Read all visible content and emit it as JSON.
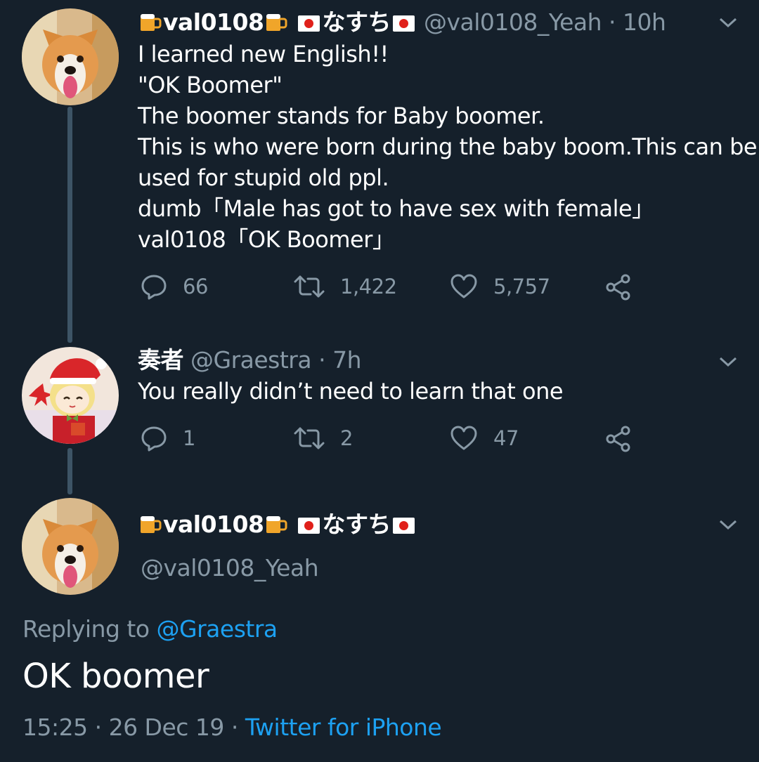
{
  "tweet1": {
    "display_name": "val0108",
    "name_suffix": "なすち",
    "handle": "@val0108_Yeah",
    "time": "10h",
    "lines": [
      "I learned new English!!",
      "\"OK Boomer\"",
      "The boomer stands for Baby boomer.",
      "This is who were born during the baby boom.This can be",
      "used for stupid old ppl.",
      "dumb「Male has got to have sex with female」",
      "val0108「OK Boomer」"
    ],
    "replies": "66",
    "retweets": "1,422",
    "likes": "5,757"
  },
  "tweet2": {
    "display_name": "奏者",
    "handle": "@Graestra",
    "time": "7h",
    "text": "You really didn’t need to learn that one",
    "replies": "1",
    "retweets": "2",
    "likes": "47"
  },
  "tweet3": {
    "display_name": "val0108",
    "name_suffix": "なすち",
    "handle": "@val0108_Yeah",
    "replying_prefix": "Replying to",
    "replying_to": "@Graestra",
    "text": "OK boomer",
    "timestamp": "15:25 · 26 Dec 19 · ",
    "source": "Twitter for iPhone"
  },
  "colors": {
    "background": "#15202b",
    "muted": "#8899a6",
    "link": "#1da1f2",
    "thread_line": "#3d5466"
  }
}
